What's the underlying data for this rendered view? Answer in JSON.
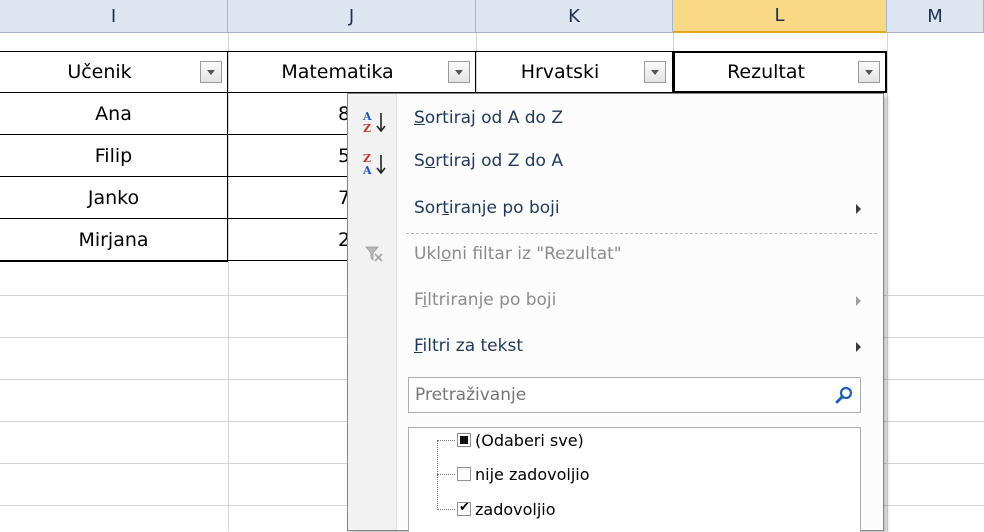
{
  "columns": [
    "I",
    "J",
    "K",
    "L",
    "M"
  ],
  "table": {
    "headers": [
      "Učenik",
      "Matematika",
      "Hrvatski",
      "Rezultat"
    ],
    "students": [
      "Ana",
      "Filip",
      "Janko",
      "Mirjana"
    ],
    "math_partial": [
      "8",
      "5",
      "7",
      "2"
    ]
  },
  "menu": {
    "sort_az": {
      "u": "S",
      "rest": "ortiraj od A do Z"
    },
    "sort_za": {
      "pre": "S",
      "u": "o",
      "rest": "rtiraj od Z do A"
    },
    "sort_color": {
      "pre": "Sor",
      "u": "t",
      "rest": "iranje po boji"
    },
    "clear_filter": {
      "pre": "Ukl",
      "u": "o",
      "rest": "ni filtar iz \"Rezultat\""
    },
    "filter_color": {
      "pre": "F",
      "u": "i",
      "rest": "ltriranje po boji"
    },
    "text_filters": {
      "u": "F",
      "rest": "iltri za tekst"
    },
    "search_placeholder": "Pretraživanje",
    "items": [
      {
        "label": "(Odaberi sve)",
        "state": "partial"
      },
      {
        "label": "nije zadovoljio",
        "state": "unchecked"
      },
      {
        "label": "zadovoljio",
        "state": "checked"
      }
    ]
  },
  "colors": {
    "header_bg": "#dde5f1",
    "active_header_bg": "#f9d985",
    "menu_text": "#1e395b"
  },
  "icons": [
    "sort-az-icon",
    "sort-za-icon",
    "clear-filter-icon",
    "search-icon",
    "submenu-arrow-icon",
    "filter-dropdown-icon"
  ]
}
